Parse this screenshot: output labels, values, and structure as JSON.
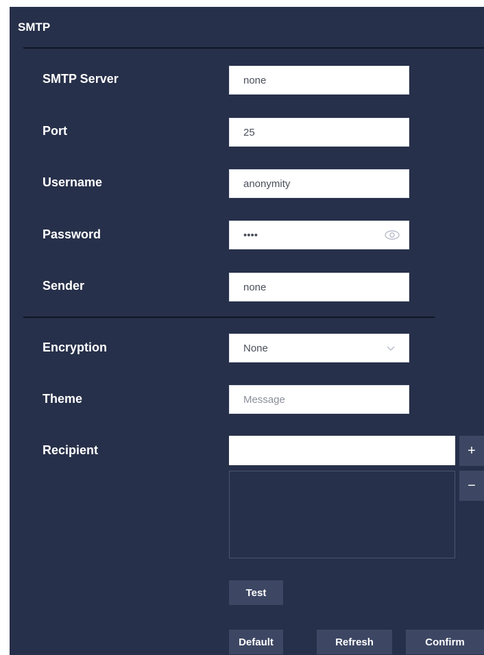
{
  "section": {
    "title": "SMTP"
  },
  "fields": {
    "smtp_server": {
      "label": "SMTP Server",
      "value": "none"
    },
    "port": {
      "label": "Port",
      "value": "25"
    },
    "username": {
      "label": "Username",
      "value": "anonymity"
    },
    "password": {
      "label": "Password",
      "value": "••••"
    },
    "sender": {
      "label": "Sender",
      "value": "none"
    },
    "encryption": {
      "label": "Encryption",
      "value": "None"
    },
    "theme": {
      "label": "Theme",
      "placeholder": "Message"
    },
    "recipient": {
      "label": "Recipient"
    }
  },
  "buttons": {
    "add": "+",
    "remove": "−",
    "test": "Test",
    "default": "Default",
    "refresh": "Refresh",
    "confirm": "Confirm"
  },
  "icons": {
    "password_toggle": "eye-icon",
    "dropdown": "chevron-down-icon"
  },
  "colors": {
    "panel_bg": "#27304a",
    "button_bg": "#3d4763",
    "divider": "#0f1526"
  }
}
